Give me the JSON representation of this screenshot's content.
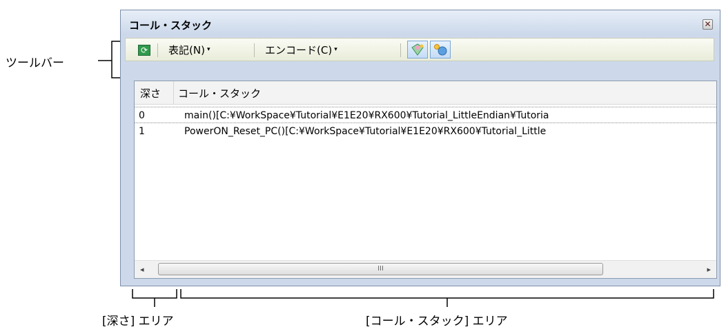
{
  "annotations": {
    "toolbar_label": "ツールバー",
    "depth_area_label": "[深さ] エリア",
    "callstack_area_label": "[コール・スタック] エリア"
  },
  "window": {
    "title": "コール・スタック",
    "close_symbol": "✕"
  },
  "toolbar": {
    "refresh_icon": "refresh-icon",
    "notation_label": "表記(N)",
    "encoding_label": "エンコード(C)",
    "dropdown_symbol": "▾"
  },
  "table": {
    "headers": [
      "深さ",
      "コール・スタック"
    ],
    "rows": [
      {
        "depth": "0",
        "callstack": "main()[C:¥WorkSpace¥Tutorial¥E1E20¥RX600¥Tutorial_LittleEndian¥Tutoria"
      },
      {
        "depth": "1",
        "callstack": "PowerON_Reset_PC()[C:¥WorkSpace¥Tutorial¥E1E20¥RX600¥Tutorial_Little"
      }
    ]
  },
  "scrollbar": {
    "left_arrow": "◂",
    "right_arrow": "▸",
    "grip": "III"
  }
}
